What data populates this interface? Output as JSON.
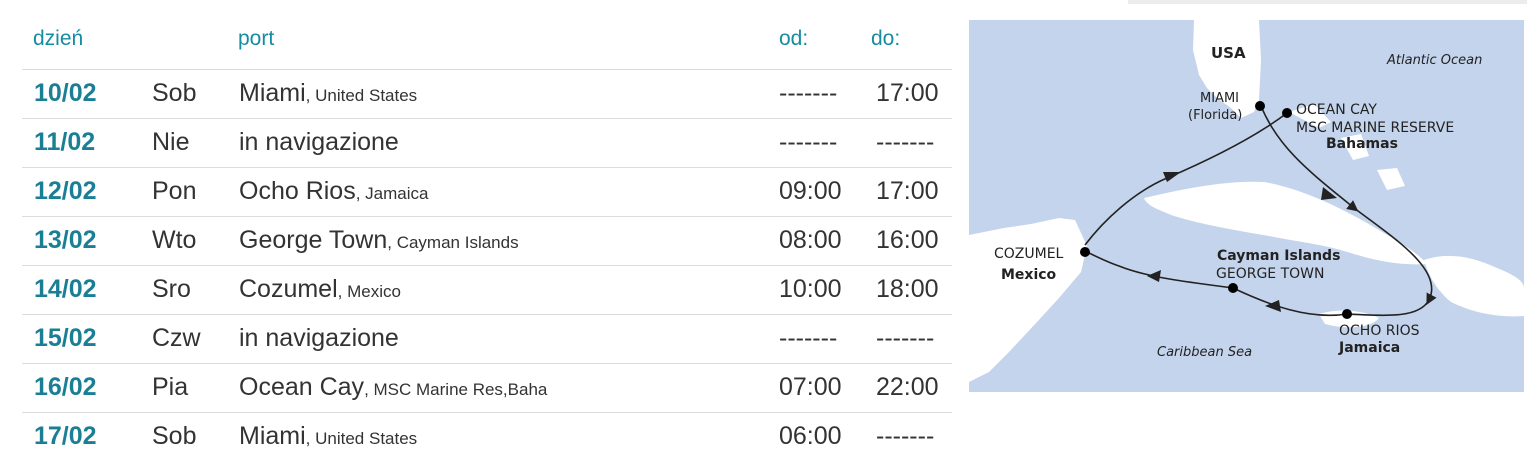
{
  "table": {
    "headers": {
      "day": "dzień",
      "port": "port",
      "from": "od:",
      "to": "do:"
    },
    "rows": [
      {
        "date": "10/02",
        "day": "Sob",
        "port": "Miami",
        "country": ", United States",
        "from": "-------",
        "to": "17:00"
      },
      {
        "date": "11/02",
        "day": "Nie",
        "port": "in navigazione",
        "country": "",
        "from": "-------",
        "to": "-------"
      },
      {
        "date": "12/02",
        "day": "Pon",
        "port": "Ocho Rios",
        "country": ", Jamaica",
        "from": "09:00",
        "to": "17:00"
      },
      {
        "date": "13/02",
        "day": "Wto",
        "port": "George Town",
        "country": ", Cayman Islands",
        "from": "08:00",
        "to": "16:00"
      },
      {
        "date": "14/02",
        "day": "Sro",
        "port": "Cozumel",
        "country": ", Mexico",
        "from": "10:00",
        "to": "18:00"
      },
      {
        "date": "15/02",
        "day": "Czw",
        "port": "in navigazione",
        "country": "",
        "from": "-------",
        "to": "-------"
      },
      {
        "date": "16/02",
        "day": "Pia",
        "port": "Ocean Cay",
        "country": ", MSC Marine Res,Baha",
        "from": "07:00",
        "to": "22:00"
      },
      {
        "date": "17/02",
        "day": "Sob",
        "port": "Miami",
        "country": ", United States",
        "from": "06:00",
        "to": "-------"
      }
    ]
  },
  "map": {
    "labels": {
      "usa": "USA",
      "atlantic": "Atlantic Ocean",
      "miami": "MIAMI",
      "florida": "(Florida)",
      "ocean_cay": "OCEAN CAY",
      "marine_reserve": "MSC MARINE RESERVE",
      "bahamas": "Bahamas",
      "cozumel": "COZUMEL",
      "mexico": "Mexico",
      "cayman": "Cayman Islands",
      "george_town": "GEORGE TOWN",
      "ocho_rios": "OCHO RIOS",
      "jamaica": "Jamaica",
      "caribbean": "Caribbean Sea"
    },
    "colors": {
      "sea": "#c4d4ec",
      "land": "#ffffff",
      "route": "#222222",
      "port_dot": "#000000"
    }
  }
}
